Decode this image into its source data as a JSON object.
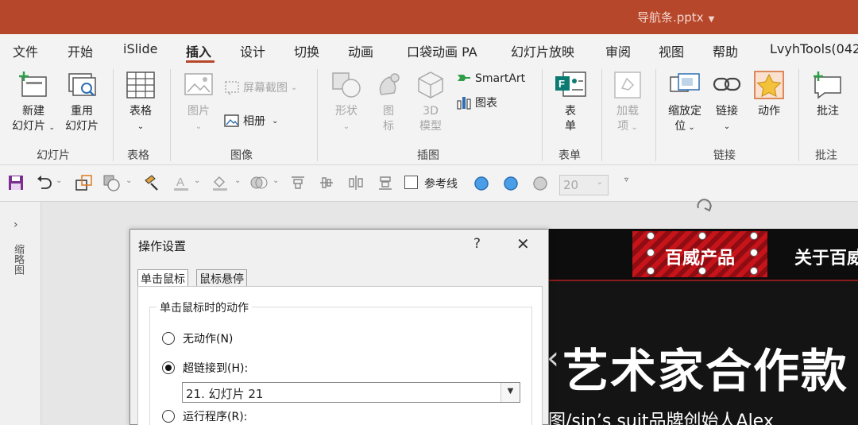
{
  "window": {
    "title": "导航条.pptx",
    "accent": "#b7472a"
  },
  "menu": {
    "tabs": [
      "文件",
      "开始",
      "iSlide",
      "插入",
      "设计",
      "切换",
      "动画",
      "口袋动画 PA",
      "幻灯片放映",
      "审阅",
      "视图",
      "帮助",
      "LvyhTools(042"
    ],
    "active": "插入"
  },
  "ribbon": {
    "slides": {
      "new_line1": "新建",
      "new_line2": "幻灯片",
      "reuse_line1": "重用",
      "reuse_line2": "幻灯片",
      "group": "幻灯片"
    },
    "tables": {
      "table": "表格",
      "group": "表格"
    },
    "images": {
      "picture_line1": "图片",
      "screenshot": "屏幕截图",
      "album": "相册",
      "group": "图像"
    },
    "illustrations": {
      "shapes": "形状",
      "icons_line1": "图",
      "icons_line2": "标",
      "model_line1": "3D",
      "model_line2": "模型",
      "smartart": "SmartArt",
      "chart": "图表",
      "group": "插图"
    },
    "forms": {
      "form_line1": "表",
      "form_line2": "单",
      "group": "表单"
    },
    "addins": {
      "line1": "加载",
      "line2": "项"
    },
    "links": {
      "zoom_line1": "缩放定",
      "zoom_line2": "位",
      "link_line1": "链接",
      "action": "动作",
      "group": "链接"
    },
    "comments": {
      "comment": "批注",
      "group": "批注"
    }
  },
  "qat": {
    "guides_label": "参考线",
    "font_size": "20"
  },
  "thumbnail_panel": {
    "label": "缩略图"
  },
  "slide": {
    "badge": "百威产品",
    "about": "关于百威",
    "headline": "艺术家合作款",
    "subline": "图/sin’s suit品牌创始人Alex"
  },
  "dialog": {
    "title": "操作设置",
    "help": "?",
    "tabs": [
      "单击鼠标",
      "鼠标悬停"
    ],
    "group_title": "单击鼠标时的动作",
    "options": {
      "none": "无动作(N)",
      "hyperlink": "超链接到(H):",
      "run_program": "运行程序(R):"
    },
    "hyperlink_target": "21. 幻灯片 21"
  }
}
